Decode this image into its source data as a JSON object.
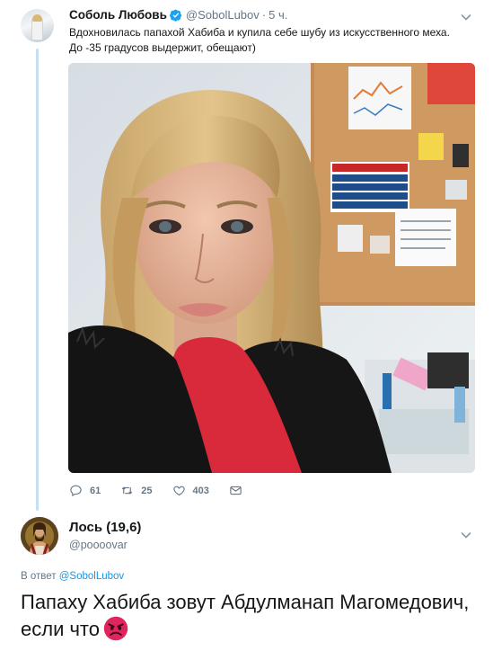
{
  "tweet": {
    "author_name": "Соболь Любовь",
    "author_handle": "@SobolLubov",
    "separator": "·",
    "time": "5 ч.",
    "text": "Вдохновилась папахой Хабиба и купила себе шубу из искусственного меха. До -35 градусов выдержит, обещают)",
    "stats": {
      "replies": "61",
      "retweets": "25",
      "likes": "403"
    }
  },
  "reply": {
    "author_name": "Лось (19,6)",
    "author_handle": "@poooovar",
    "reply_prefix": "В ответ",
    "reply_to_handle": "@SobolLubov",
    "text": "Папаху Хабиба зовут Абдулманап Магомедович, если что"
  },
  "icons": {
    "verified": "verified-badge-icon",
    "chevron": "chevron-down-icon",
    "reply": "reply-icon",
    "retweet": "retweet-icon",
    "like": "heart-icon",
    "message": "envelope-icon",
    "emoji": "angry-face-icon"
  },
  "colors": {
    "link": "#1b95e0",
    "muted": "#657786",
    "text": "#14171a",
    "thread_line": "#c4e0f2",
    "emoji_red": "#e0245e"
  }
}
